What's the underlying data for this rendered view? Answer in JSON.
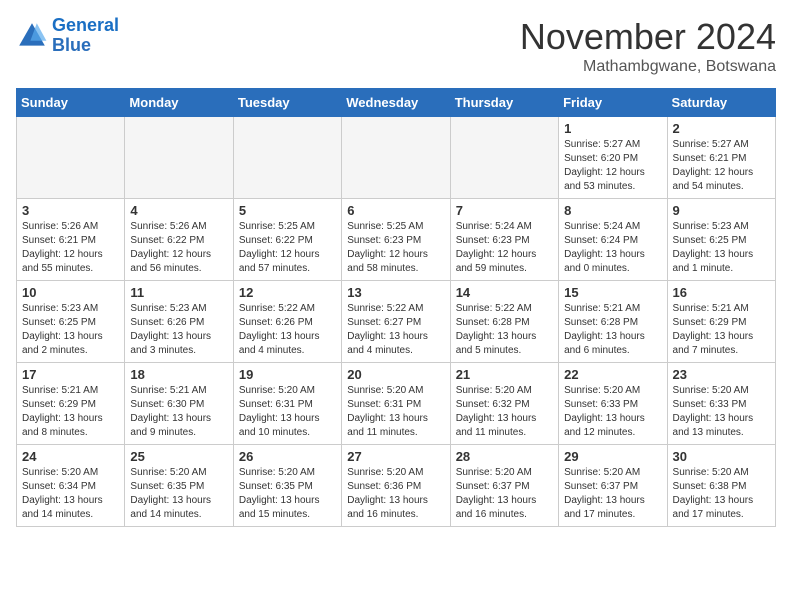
{
  "logo": {
    "line1": "General",
    "line2": "Blue"
  },
  "title": "November 2024",
  "location": "Mathambgwane, Botswana",
  "days_of_week": [
    "Sunday",
    "Monday",
    "Tuesday",
    "Wednesday",
    "Thursday",
    "Friday",
    "Saturday"
  ],
  "weeks": [
    [
      {
        "day": "",
        "info": ""
      },
      {
        "day": "",
        "info": ""
      },
      {
        "day": "",
        "info": ""
      },
      {
        "day": "",
        "info": ""
      },
      {
        "day": "",
        "info": ""
      },
      {
        "day": "1",
        "info": "Sunrise: 5:27 AM\nSunset: 6:20 PM\nDaylight: 12 hours\nand 53 minutes."
      },
      {
        "day": "2",
        "info": "Sunrise: 5:27 AM\nSunset: 6:21 PM\nDaylight: 12 hours\nand 54 minutes."
      }
    ],
    [
      {
        "day": "3",
        "info": "Sunrise: 5:26 AM\nSunset: 6:21 PM\nDaylight: 12 hours\nand 55 minutes."
      },
      {
        "day": "4",
        "info": "Sunrise: 5:26 AM\nSunset: 6:22 PM\nDaylight: 12 hours\nand 56 minutes."
      },
      {
        "day": "5",
        "info": "Sunrise: 5:25 AM\nSunset: 6:22 PM\nDaylight: 12 hours\nand 57 minutes."
      },
      {
        "day": "6",
        "info": "Sunrise: 5:25 AM\nSunset: 6:23 PM\nDaylight: 12 hours\nand 58 minutes."
      },
      {
        "day": "7",
        "info": "Sunrise: 5:24 AM\nSunset: 6:23 PM\nDaylight: 12 hours\nand 59 minutes."
      },
      {
        "day": "8",
        "info": "Sunrise: 5:24 AM\nSunset: 6:24 PM\nDaylight: 13 hours\nand 0 minutes."
      },
      {
        "day": "9",
        "info": "Sunrise: 5:23 AM\nSunset: 6:25 PM\nDaylight: 13 hours\nand 1 minute."
      }
    ],
    [
      {
        "day": "10",
        "info": "Sunrise: 5:23 AM\nSunset: 6:25 PM\nDaylight: 13 hours\nand 2 minutes."
      },
      {
        "day": "11",
        "info": "Sunrise: 5:23 AM\nSunset: 6:26 PM\nDaylight: 13 hours\nand 3 minutes."
      },
      {
        "day": "12",
        "info": "Sunrise: 5:22 AM\nSunset: 6:26 PM\nDaylight: 13 hours\nand 4 minutes."
      },
      {
        "day": "13",
        "info": "Sunrise: 5:22 AM\nSunset: 6:27 PM\nDaylight: 13 hours\nand 4 minutes."
      },
      {
        "day": "14",
        "info": "Sunrise: 5:22 AM\nSunset: 6:28 PM\nDaylight: 13 hours\nand 5 minutes."
      },
      {
        "day": "15",
        "info": "Sunrise: 5:21 AM\nSunset: 6:28 PM\nDaylight: 13 hours\nand 6 minutes."
      },
      {
        "day": "16",
        "info": "Sunrise: 5:21 AM\nSunset: 6:29 PM\nDaylight: 13 hours\nand 7 minutes."
      }
    ],
    [
      {
        "day": "17",
        "info": "Sunrise: 5:21 AM\nSunset: 6:29 PM\nDaylight: 13 hours\nand 8 minutes."
      },
      {
        "day": "18",
        "info": "Sunrise: 5:21 AM\nSunset: 6:30 PM\nDaylight: 13 hours\nand 9 minutes."
      },
      {
        "day": "19",
        "info": "Sunrise: 5:20 AM\nSunset: 6:31 PM\nDaylight: 13 hours\nand 10 minutes."
      },
      {
        "day": "20",
        "info": "Sunrise: 5:20 AM\nSunset: 6:31 PM\nDaylight: 13 hours\nand 11 minutes."
      },
      {
        "day": "21",
        "info": "Sunrise: 5:20 AM\nSunset: 6:32 PM\nDaylight: 13 hours\nand 11 minutes."
      },
      {
        "day": "22",
        "info": "Sunrise: 5:20 AM\nSunset: 6:33 PM\nDaylight: 13 hours\nand 12 minutes."
      },
      {
        "day": "23",
        "info": "Sunrise: 5:20 AM\nSunset: 6:33 PM\nDaylight: 13 hours\nand 13 minutes."
      }
    ],
    [
      {
        "day": "24",
        "info": "Sunrise: 5:20 AM\nSunset: 6:34 PM\nDaylight: 13 hours\nand 14 minutes."
      },
      {
        "day": "25",
        "info": "Sunrise: 5:20 AM\nSunset: 6:35 PM\nDaylight: 13 hours\nand 14 minutes."
      },
      {
        "day": "26",
        "info": "Sunrise: 5:20 AM\nSunset: 6:35 PM\nDaylight: 13 hours\nand 15 minutes."
      },
      {
        "day": "27",
        "info": "Sunrise: 5:20 AM\nSunset: 6:36 PM\nDaylight: 13 hours\nand 16 minutes."
      },
      {
        "day": "28",
        "info": "Sunrise: 5:20 AM\nSunset: 6:37 PM\nDaylight: 13 hours\nand 16 minutes."
      },
      {
        "day": "29",
        "info": "Sunrise: 5:20 AM\nSunset: 6:37 PM\nDaylight: 13 hours\nand 17 minutes."
      },
      {
        "day": "30",
        "info": "Sunrise: 5:20 AM\nSunset: 6:38 PM\nDaylight: 13 hours\nand 17 minutes."
      }
    ]
  ]
}
